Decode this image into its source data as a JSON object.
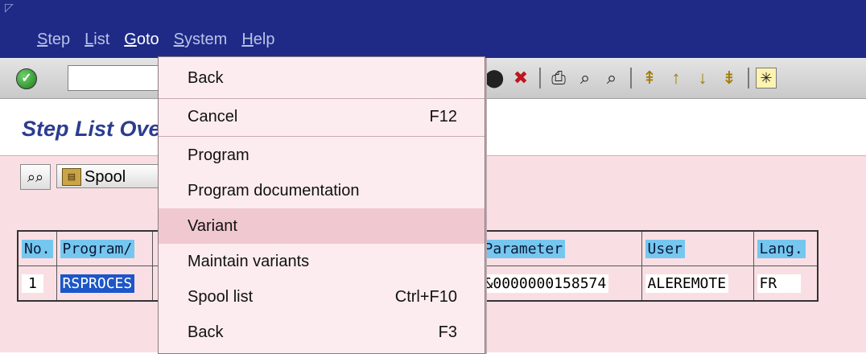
{
  "menubar": {
    "items": [
      "Step",
      "List",
      "Goto",
      "System",
      "Help"
    ],
    "open_item": "Goto"
  },
  "toolbar": {
    "command_field_value": ""
  },
  "page": {
    "title": "Step List Overview",
    "spool_button_label": "Spool"
  },
  "grid": {
    "headers": [
      "No.",
      "Program/",
      "Parameter",
      "User",
      "Lang."
    ],
    "row": {
      "no": "1",
      "program": "RSPROCES",
      "parameter": "&0000000158574",
      "user": "ALEREMOTE",
      "lang": "FR"
    }
  },
  "goto_menu": {
    "items": [
      {
        "label": "Back",
        "shortcut": ""
      },
      {
        "label": "Cancel",
        "shortcut": "F12"
      },
      {
        "label": "Program",
        "shortcut": ""
      },
      {
        "label": "Program documentation",
        "shortcut": ""
      },
      {
        "label": "Variant",
        "shortcut": ""
      },
      {
        "label": "Maintain variants",
        "shortcut": ""
      },
      {
        "label": "Spool list",
        "shortcut": "Ctrl+F10"
      },
      {
        "label": "Back",
        "shortcut": "F3"
      }
    ],
    "highlighted": "Variant"
  },
  "colors": {
    "title_bar": "#1e2a86",
    "header_cell": "#75c7ef",
    "selection": "#1c56c8",
    "background_pink": "#f9dfe4"
  }
}
